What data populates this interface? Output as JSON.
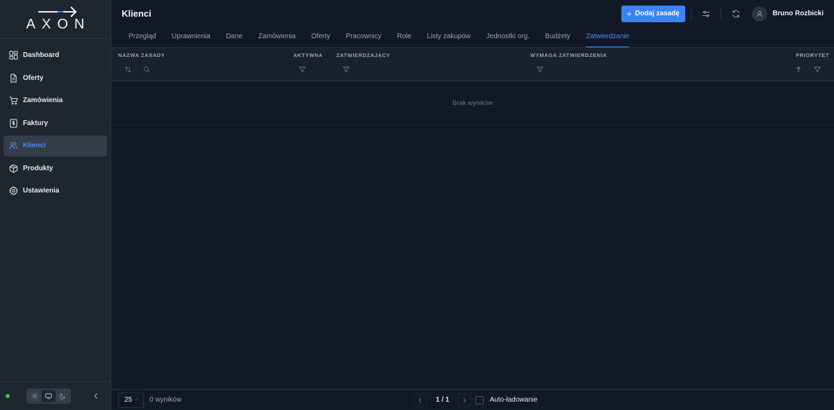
{
  "sidebar": {
    "logo_text": "AXON",
    "items": [
      {
        "label": "Dashboard",
        "icon": "dashboard-icon",
        "active": false
      },
      {
        "label": "Oferty",
        "icon": "document-icon",
        "active": false
      },
      {
        "label": "Zamówienia",
        "icon": "cart-icon",
        "active": false
      },
      {
        "label": "Faktury",
        "icon": "invoice-icon",
        "active": false
      },
      {
        "label": "Klienci",
        "icon": "users-icon",
        "active": true
      },
      {
        "label": "Produkty",
        "icon": "box-icon",
        "active": false
      },
      {
        "label": "Ustawienia",
        "icon": "gear-icon",
        "active": false
      }
    ],
    "status_color": "#22c55e"
  },
  "header": {
    "title": "Klienci",
    "add_button_label": "Dodaj zasadę",
    "user_name": "Bruno Rozbicki"
  },
  "tabs": [
    {
      "label": "Przegląd",
      "active": false
    },
    {
      "label": "Uprawnienia",
      "active": false
    },
    {
      "label": "Dane",
      "active": false
    },
    {
      "label": "Zamówienia",
      "active": false
    },
    {
      "label": "Oferty",
      "active": false
    },
    {
      "label": "Pracownicy",
      "active": false
    },
    {
      "label": "Role",
      "active": false
    },
    {
      "label": "Listy zakupów",
      "active": false
    },
    {
      "label": "Jednostki org.",
      "active": false
    },
    {
      "label": "Budżety",
      "active": false
    },
    {
      "label": "Zatwierdzanie",
      "active": true
    }
  ],
  "table": {
    "columns": {
      "name": "NAZWA ZASADY",
      "active": "AKTYWNA",
      "approvers": "ZATWIERDZAJĄCY",
      "requires": "WYMAGA ZATWIERDZENIA",
      "priority": "PRIORYTET"
    },
    "empty_text": "Brak wyników"
  },
  "footer": {
    "page_size": "25",
    "result_count": "0 wyników",
    "page_label": "1 / 1",
    "auto_label": "Auto-ładowanie"
  },
  "colors": {
    "accent": "#3b82f6",
    "active_text": "#4b8ef5",
    "background": "#111826",
    "sidebar": "#1f2630"
  }
}
